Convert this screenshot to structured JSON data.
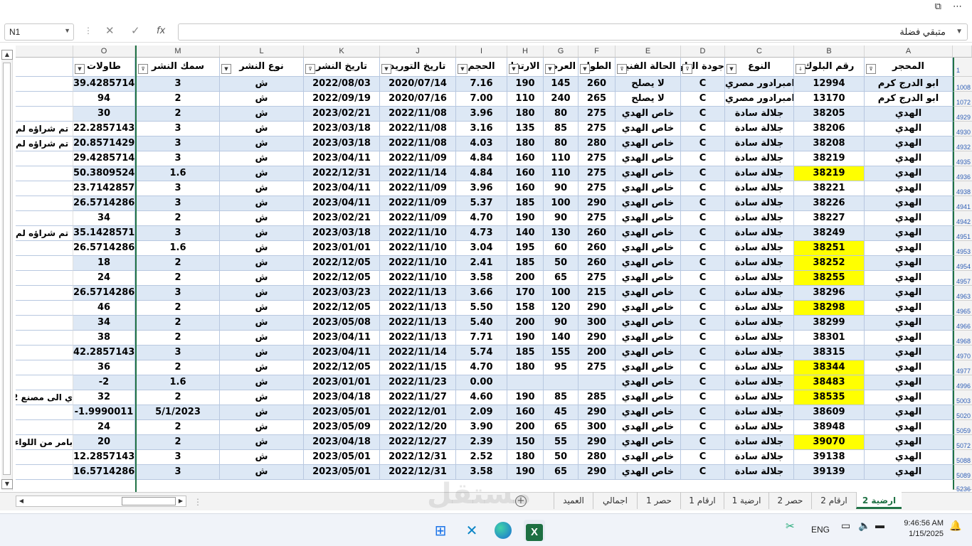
{
  "formula": {
    "namebox": "N1",
    "content": "متبقي فضلة",
    "fx": "fx"
  },
  "columns": {
    "O": "O",
    "M": "M",
    "L": "L",
    "K": "K",
    "J": "J",
    "I": "I",
    "H": "H",
    "G": "G",
    "F": "F",
    "E": "E",
    "D": "D",
    "C": "C",
    "B": "B",
    "A": "A"
  },
  "headers": {
    "O": "طاولات",
    "M": "سمك النشر",
    "L": "نوع النشر",
    "K": "تاريخ النشر",
    "J": "تاريخ التوريد",
    "I": "الحجم",
    "H": "الارتفا",
    "G": "العرض",
    "F": "الطول",
    "E": "الحالة الفنية",
    "D": "جودة البلوك",
    "C": "النوع",
    "B": "رقم البلوك",
    "A": "المحجر",
    "row1": "1"
  },
  "rows": [
    {
      "r": "1008",
      "a": "ابو الدرج كرم",
      "b": "12994",
      "c": "امبرادور مصري",
      "d": "C",
      "e": "لا يصلح",
      "f": "260",
      "g": "145",
      "h": "190",
      "i": "7.16",
      "j": "2020/07/14",
      "k": "2022/08/03",
      "l": "ش",
      "m": "3",
      "o": "39.4285714",
      "note": ""
    },
    {
      "r": "1072",
      "a": "ابو الدرج كرم",
      "b": "13170",
      "c": "امبرادور مصري",
      "d": "C",
      "e": "لا يصلح",
      "f": "265",
      "g": "240",
      "h": "110",
      "i": "7.00",
      "j": "2020/07/16",
      "k": "2022/09/19",
      "l": "ش",
      "m": "2",
      "o": "94",
      "note": ""
    },
    {
      "r": "4929",
      "a": "الهدي",
      "b": "38205",
      "c": "جلالة سادة",
      "d": "C",
      "e": "خاص الهدي",
      "f": "275",
      "g": "80",
      "h": "180",
      "i": "3.96",
      "j": "2022/11/08",
      "k": "2023/02/21",
      "l": "ش",
      "m": "2",
      "o": "30",
      "note": ""
    },
    {
      "r": "4930",
      "a": "الهدي",
      "b": "38206",
      "c": "جلالة سادة",
      "d": "C",
      "e": "خاص الهدي",
      "f": "275",
      "g": "85",
      "h": "135",
      "i": "3.16",
      "j": "2022/11/08",
      "k": "2023/03/18",
      "l": "ش",
      "m": "3",
      "o": "22.2857143",
      "note": "تم شراؤه لم"
    },
    {
      "r": "4932",
      "a": "الهدي",
      "b": "38208",
      "c": "جلالة سادة",
      "d": "C",
      "e": "خاص الهدي",
      "f": "280",
      "g": "80",
      "h": "180",
      "i": "4.03",
      "j": "2022/11/08",
      "k": "2023/03/18",
      "l": "ش",
      "m": "3",
      "o": "20.8571429",
      "note": "تم شراؤه لم"
    },
    {
      "r": "4935",
      "a": "الهدي",
      "b": "38219",
      "c": "جلالة سادة",
      "d": "C",
      "e": "خاص الهدي",
      "f": "275",
      "g": "110",
      "h": "160",
      "i": "4.84",
      "j": "2022/11/09",
      "k": "2023/04/11",
      "l": "ش",
      "m": "3",
      "o": "29.4285714",
      "note": ""
    },
    {
      "r": "4936",
      "a": "الهدي",
      "b": "38219",
      "c": "جلالة سادة",
      "d": "C",
      "e": "خاص الهدي",
      "f": "275",
      "g": "110",
      "h": "160",
      "i": "4.84",
      "j": "2022/11/14",
      "k": "2022/12/31",
      "l": "ش",
      "m": "1.6",
      "o": "50.3809524",
      "note": "",
      "hl": true
    },
    {
      "r": "4938",
      "a": "الهدي",
      "b": "38221",
      "c": "جلالة سادة",
      "d": "C",
      "e": "خاص الهدي",
      "f": "275",
      "g": "90",
      "h": "160",
      "i": "3.96",
      "j": "2022/11/09",
      "k": "2023/04/11",
      "l": "ش",
      "m": "3",
      "o": "23.7142857",
      "note": ""
    },
    {
      "r": "4941",
      "a": "الهدي",
      "b": "38226",
      "c": "جلالة سادة",
      "d": "C",
      "e": "خاص الهدي",
      "f": "290",
      "g": "100",
      "h": "185",
      "i": "5.37",
      "j": "2022/11/09",
      "k": "2023/04/11",
      "l": "ش",
      "m": "3",
      "o": "26.5714286",
      "note": ""
    },
    {
      "r": "4942",
      "a": "الهدي",
      "b": "38227",
      "c": "جلالة سادة",
      "d": "C",
      "e": "خاص الهدي",
      "f": "275",
      "g": "90",
      "h": "190",
      "i": "4.70",
      "j": "2022/11/09",
      "k": "2023/02/21",
      "l": "ش",
      "m": "2",
      "o": "34",
      "note": ""
    },
    {
      "r": "4951",
      "a": "الهدي",
      "b": "38249",
      "c": "جلالة سادة",
      "d": "C",
      "e": "خاص الهدي",
      "f": "260",
      "g": "130",
      "h": "140",
      "i": "4.73",
      "j": "2022/11/10",
      "k": "2023/03/18",
      "l": "ش",
      "m": "3",
      "o": "35.1428571",
      "note": "تم شراؤه لم"
    },
    {
      "r": "4953",
      "a": "الهدي",
      "b": "38251",
      "c": "جلالة سادة",
      "d": "C",
      "e": "خاص الهدي",
      "f": "260",
      "g": "60",
      "h": "195",
      "i": "3.04",
      "j": "2022/11/10",
      "k": "2023/01/01",
      "l": "ش",
      "m": "1.6",
      "o": "26.5714286",
      "note": "",
      "hl": true
    },
    {
      "r": "4954",
      "a": "الهدي",
      "b": "38252",
      "c": "جلالة سادة",
      "d": "C",
      "e": "خاص الهدي",
      "f": "260",
      "g": "50",
      "h": "185",
      "i": "2.41",
      "j": "2022/11/10",
      "k": "2022/12/05",
      "l": "ش",
      "m": "2",
      "o": "18",
      "note": "",
      "hl": true
    },
    {
      "r": "4957",
      "a": "الهدي",
      "b": "38255",
      "c": "جلالة سادة",
      "d": "C",
      "e": "خاص الهدي",
      "f": "275",
      "g": "65",
      "h": "200",
      "i": "3.58",
      "j": "2022/11/10",
      "k": "2022/12/05",
      "l": "ش",
      "m": "2",
      "o": "24",
      "note": "",
      "hl": true
    },
    {
      "r": "4963",
      "a": "الهدي",
      "b": "38296",
      "c": "جلالة سادة",
      "d": "C",
      "e": "خاص الهدي",
      "f": "215",
      "g": "100",
      "h": "170",
      "i": "3.66",
      "j": "2022/11/13",
      "k": "2023/03/23",
      "l": "ش",
      "m": "3",
      "o": "26.5714286",
      "note": ""
    },
    {
      "r": "4965",
      "a": "الهدي",
      "b": "38298",
      "c": "جلالة سادة",
      "d": "C",
      "e": "خاص الهدي",
      "f": "290",
      "g": "120",
      "h": "158",
      "i": "5.50",
      "j": "2022/11/13",
      "k": "2022/12/05",
      "l": "ش",
      "m": "2",
      "o": "46",
      "note": "",
      "hl": true
    },
    {
      "r": "4966",
      "a": "الهدي",
      "b": "38299",
      "c": "جلالة سادة",
      "d": "C",
      "e": "خاص الهدي",
      "f": "300",
      "g": "90",
      "h": "200",
      "i": "5.40",
      "j": "2022/11/13",
      "k": "2023/05/08",
      "l": "ش",
      "m": "2",
      "o": "34",
      "note": ""
    },
    {
      "r": "4968",
      "a": "الهدي",
      "b": "38301",
      "c": "جلالة سادة",
      "d": "C",
      "e": "خاص الهدي",
      "f": "290",
      "g": "140",
      "h": "190",
      "i": "7.71",
      "j": "2022/11/13",
      "k": "2023/04/11",
      "l": "ش",
      "m": "2",
      "o": "38",
      "note": ""
    },
    {
      "r": "4970",
      "a": "الهدي",
      "b": "38315",
      "c": "جلالة سادة",
      "d": "C",
      "e": "خاص الهدي",
      "f": "200",
      "g": "155",
      "h": "185",
      "i": "5.74",
      "j": "2022/11/14",
      "k": "2023/04/11",
      "l": "ش",
      "m": "3",
      "o": "42.2857143",
      "note": ""
    },
    {
      "r": "4977",
      "a": "الهدي",
      "b": "38344",
      "c": "جلالة سادة",
      "d": "C",
      "e": "خاص الهدي",
      "f": "275",
      "g": "95",
      "h": "180",
      "i": "4.70",
      "j": "2022/11/15",
      "k": "2022/12/05",
      "l": "ش",
      "m": "2",
      "o": "36",
      "note": "",
      "hl": true
    },
    {
      "r": "4996",
      "a": "الهدي",
      "b": "38483",
      "c": "جلالة سادة",
      "d": "C",
      "e": "خاص الهدي",
      "f": "",
      "g": "",
      "h": "",
      "i": "0.00",
      "j": "2022/11/23",
      "k": "2023/01/01",
      "l": "ش",
      "m": "1.6",
      "o": "-2",
      "note": "",
      "hl": true
    },
    {
      "r": "5003",
      "a": "الهدي",
      "b": "38535",
      "c": "جلالة سادة",
      "d": "C",
      "e": "خاص الهدي",
      "f": "285",
      "g": "85",
      "h": "190",
      "i": "4.60",
      "j": "2022/11/27",
      "k": "2023/04/18",
      "l": "ش",
      "m": "2",
      "o": "32",
      "note": "ي الى مصنع 2",
      "hl": true
    },
    {
      "r": "5020",
      "a": "الهدي",
      "b": "38609",
      "c": "جلالة سادة",
      "d": "C",
      "e": "خاص الهدي",
      "f": "290",
      "g": "45",
      "h": "160",
      "i": "2.09",
      "j": "2022/12/01",
      "k": "2023/05/01",
      "l": "ش",
      "m": "5/1/2023",
      "o": "-1.9990011",
      "note": ""
    },
    {
      "r": "5059",
      "a": "الهدي",
      "b": "38948",
      "c": "جلالة سادة",
      "d": "C",
      "e": "خاص الهدي",
      "f": "300",
      "g": "65",
      "h": "200",
      "i": "3.90",
      "j": "2022/12/20",
      "k": "2023/05/09",
      "l": "ش",
      "m": "2",
      "o": "24",
      "note": ""
    },
    {
      "r": "5072",
      "a": "الهدي",
      "b": "39070",
      "c": "جلالة سادة",
      "d": "C",
      "e": "خاص الهدي",
      "f": "290",
      "g": "55",
      "h": "150",
      "i": "2.39",
      "j": "2022/12/27",
      "k": "2023/04/18",
      "l": "ش",
      "m": "2",
      "o": "20",
      "note": "بامر من اللواء",
      "hl": true
    },
    {
      "r": "5088",
      "a": "الهدي",
      "b": "39138",
      "c": "جلالة سادة",
      "d": "C",
      "e": "خاص الهدي",
      "f": "280",
      "g": "50",
      "h": "180",
      "i": "2.52",
      "j": "2022/12/31",
      "k": "2023/05/01",
      "l": "ش",
      "m": "3",
      "o": "12.2857143",
      "note": ""
    },
    {
      "r": "5089",
      "a": "الهدي",
      "b": "39139",
      "c": "جلالة سادة",
      "d": "C",
      "e": "خاص الهدي",
      "f": "290",
      "g": "65",
      "h": "190",
      "i": "3.58",
      "j": "2022/12/31",
      "k": "2023/05/01",
      "l": "ش",
      "m": "3",
      "o": "16.5714286",
      "note": ""
    }
  ],
  "last_row": "5236",
  "tabs": [
    "ارضية 2",
    "ارقام 2",
    "حصر 2",
    "ارضية 1",
    "ارقام 1",
    "حصر 1",
    "اجمالي",
    "العميد"
  ],
  "add_sheet": "+",
  "taskbar": {
    "lang": "ENG",
    "time": "9:46:56 AM",
    "date": "1/15/2025"
  },
  "watermark": "مستقل"
}
